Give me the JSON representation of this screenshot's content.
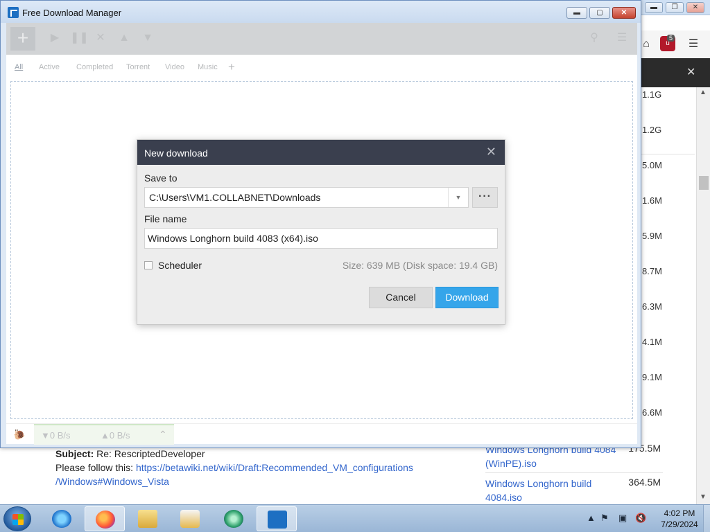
{
  "fdm_window": {
    "title": "Free Download Manager",
    "tabs": [
      "All",
      "Active",
      "Completed",
      "Torrent",
      "Video",
      "Music"
    ],
    "add_tab_symbol": "+",
    "add_button_symbol": "+",
    "status": {
      "download_speed": "▼0 B/s",
      "upload_speed": "▲0 B/s"
    }
  },
  "dialog": {
    "title": "New download",
    "close_symbol": "✕",
    "save_to_label": "Save to",
    "save_to_value": "C:\\Users\\VM1.COLLABNET\\Downloads",
    "browse_label": "···",
    "file_name_label": "File name",
    "file_name_value": "Windows Longhorn build 4083 (x64).iso",
    "scheduler_label": "Scheduler",
    "size_info": "Size: 639 MB (Disk space: 19.4 GB)",
    "cancel_label": "Cancel",
    "download_label": "Download"
  },
  "background": {
    "extension_badge_count": "5",
    "sizes": [
      "1.1G",
      "1.2G",
      "5.0M",
      "1.6M",
      "5.9M",
      "8.7M",
      "6.3M",
      "4.1M",
      "9.1M",
      "6.6M"
    ],
    "email": {
      "subject_label": "Subject:",
      "subject_value": "Re: RescriptedDeveloper",
      "body_prefix": "Please follow this:",
      "link_line1": "https://betawiki.net/wiki/Draft:Recommended_VM_configurations",
      "link_line2": "/Windows#Windows_Vista"
    },
    "side_list": [
      {
        "name": "Windows Longhorn build 4084 (WinPE).iso",
        "size": "175.5M"
      },
      {
        "name": "Windows Longhorn build 4084.iso",
        "size": "364.5M"
      }
    ]
  },
  "taskbar": {
    "clock_time": "4:02 PM",
    "clock_date": "7/29/2024",
    "items": [
      "internet-explorer",
      "firefox",
      "file-explorer",
      "media-player",
      "app-circle",
      "free-download-manager"
    ]
  },
  "colors": {
    "dialog_header": "#3a3f4e",
    "download_button": "#35a5ea",
    "link": "#3366cc"
  }
}
